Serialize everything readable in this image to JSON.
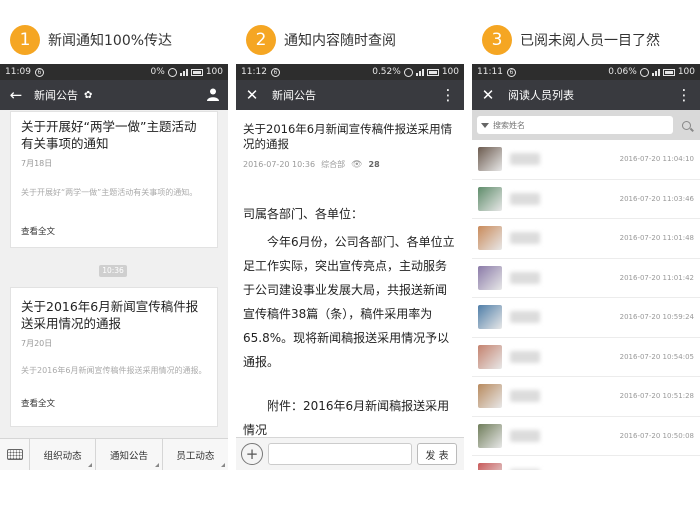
{
  "steps": [
    {
      "num": "1",
      "caption": "新闻通知100%传达"
    },
    {
      "num": "2",
      "caption": "通知内容随时查阅"
    },
    {
      "num": "3",
      "caption": "已阅未阅人员一目了然"
    }
  ],
  "phone1": {
    "status": {
      "time": "11:09",
      "net": "0%",
      "batt": "100"
    },
    "title": "新闻公告",
    "cards": [
      {
        "title": "关于开展好“两学一做”主题活动有关事项的通知",
        "date": "7月18日",
        "summary": "关于开展好“两学一做”主题活动有关事项的通知。",
        "more": "查看全文"
      },
      {
        "title": "关于2016年6月新闻宣传稿件报送采用情况的通报",
        "date": "7月20日",
        "summary": "关于2016年6月新闻宣传稿件报送采用情况的通报。",
        "more": "查看全文"
      }
    ],
    "time_pill": "10:36",
    "bottom_menu": [
      "组织动态",
      "通知公告",
      "员工动态"
    ]
  },
  "phone2": {
    "status": {
      "time": "11:12",
      "net": "0.52%",
      "batt": "100"
    },
    "title": "新闻公告",
    "article": {
      "title": "关于2016年6月新闻宣传稿件报送采用情况的通报",
      "date": "2016-07-20 10:36",
      "dept": "综合部",
      "views": "28",
      "salutation": "司属各部门、各单位：",
      "body": "今年6月份，公司各部门、各单位立足工作实际，突出宣传亮点，主动服务于公司建设事业发展大局，共报送新闻宣传稿件38篇（条），稿件采用率为65.8%。现将新闻稿报送采用情况予以通报。",
      "attachment": "附件：2016年6月新闻稿报送采用情况"
    },
    "send_label": "发 表"
  },
  "phone3": {
    "status": {
      "time": "11:11",
      "net": "0.06%",
      "batt": "100"
    },
    "title": "阅读人员列表",
    "search_placeholder": "搜索姓名",
    "readers": [
      {
        "time": "2016-07-20 11:04:10",
        "avatar_color": "#6b5a4e"
      },
      {
        "time": "2016-07-20 11:03:46",
        "avatar_color": "#5e8c6a"
      },
      {
        "time": "2016-07-20 11:01:48",
        "avatar_color": "#c98a5a"
      },
      {
        "time": "2016-07-20 11:01:42",
        "avatar_color": "#8a7aa8"
      },
      {
        "time": "2016-07-20 10:59:24",
        "avatar_color": "#4f7ea8"
      },
      {
        "time": "2016-07-20 10:54:05",
        "avatar_color": "#c4826e"
      },
      {
        "time": "2016-07-20 10:51:28",
        "avatar_color": "#b88a5e"
      },
      {
        "time": "2016-07-20 10:50:08",
        "avatar_color": "#6f7d5a"
      },
      {
        "time": "2016-07-20 10:46:15",
        "avatar_color": "#c95a5a"
      }
    ]
  }
}
